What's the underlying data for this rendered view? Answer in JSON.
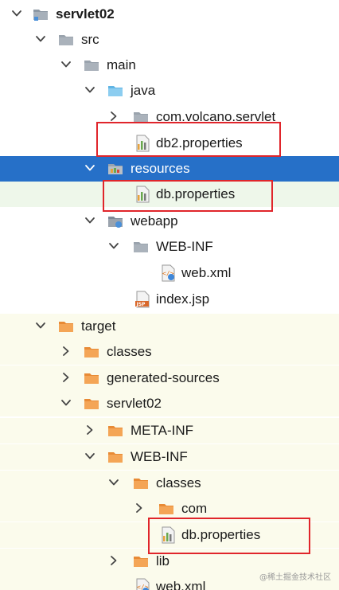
{
  "tree": {
    "root_label": "servlet02",
    "src_label": "src",
    "main_label": "main",
    "java_label": "java",
    "package_label": "com.volcano.servlet",
    "db2_props_label": "db2.properties",
    "resources_label": "resources",
    "db_props_label": "db.properties",
    "webapp_label": "webapp",
    "webinf_label": "WEB-INF",
    "webxml_label": "web.xml",
    "indexjsp_label": "index.jsp",
    "target_label": "target",
    "classes_label": "classes",
    "generated_sources_label": "generated-sources",
    "target_servlet_label": "servlet02",
    "metainf_label": "META-INF",
    "target_webinf_label": "WEB-INF",
    "target_classes_label": "classes",
    "com_label": "com",
    "target_db_props_label": "db.properties",
    "lib_label": "lib",
    "target_webxml_label": "web.xml"
  },
  "watermark": "@稀土掘金技术社区",
  "colors": {
    "selection": "#2670c8",
    "highlight_border": "#e0252b",
    "folder_orange": "#f2a04e",
    "folder_gray": "#9aa3ad",
    "folder_blue": "#7ec3ea",
    "target_bg": "#fbfbec"
  },
  "icons": {
    "chevron_right": "chevron-right-icon",
    "chevron_down": "chevron-down-icon",
    "folder": "folder-icon",
    "properties": "properties-file-icon",
    "xml": "xml-file-icon",
    "jsp": "jsp-file-icon"
  }
}
